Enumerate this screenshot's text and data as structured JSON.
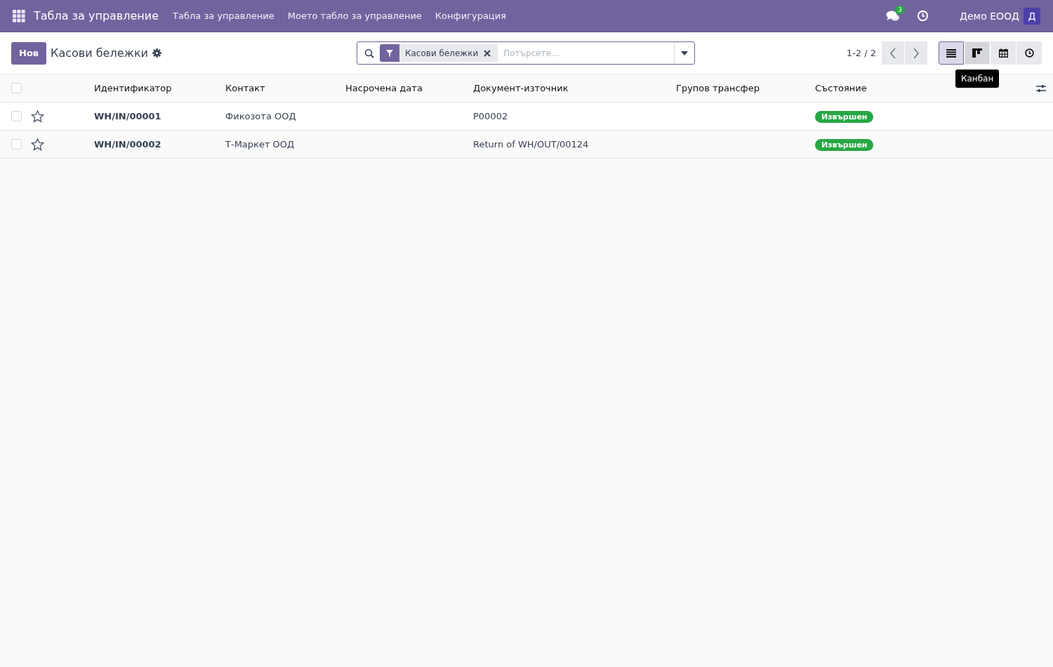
{
  "navbar": {
    "app_title": "Табла за управление",
    "menu": [
      "Табла за управление",
      "Моето табло за управление",
      "Конфигурация"
    ],
    "messages_badge": "3",
    "company": "Демо ЕООД",
    "avatar_letter": "Д"
  },
  "control_panel": {
    "new_button": "Нов",
    "title": "Касови бележки",
    "search": {
      "facet": "Касови бележки",
      "placeholder": "Потърсете..."
    },
    "pager": "1-2 / 2",
    "views": [
      {
        "kind": "list",
        "selected": true
      },
      {
        "kind": "kanban",
        "selected": false
      },
      {
        "kind": "calendar",
        "selected": false
      },
      {
        "kind": "activity",
        "selected": false
      }
    ],
    "tooltip": "Канбан"
  },
  "table": {
    "select_all_checked": false,
    "columns": [
      "Идентификатор",
      "Контакт",
      "Насрочена дата",
      "Документ-източник",
      "Групов трансфер",
      "Състояние"
    ],
    "rows": [
      {
        "checked": false,
        "starred": false,
        "reference": "WH/IN/00001",
        "contact": "Фикозота ООД",
        "scheduled_date": "",
        "source_document": "P00002",
        "batch": "",
        "status": {
          "label": "Извършен",
          "color": "#28a745"
        }
      },
      {
        "checked": false,
        "starred": false,
        "reference": "WH/IN/00002",
        "contact": "Т-Маркет ООД",
        "scheduled_date": "",
        "source_document": "Return of WH/OUT/00124",
        "batch": "",
        "status": {
          "label": "Извършен",
          "color": "#28a745"
        }
      }
    ]
  }
}
